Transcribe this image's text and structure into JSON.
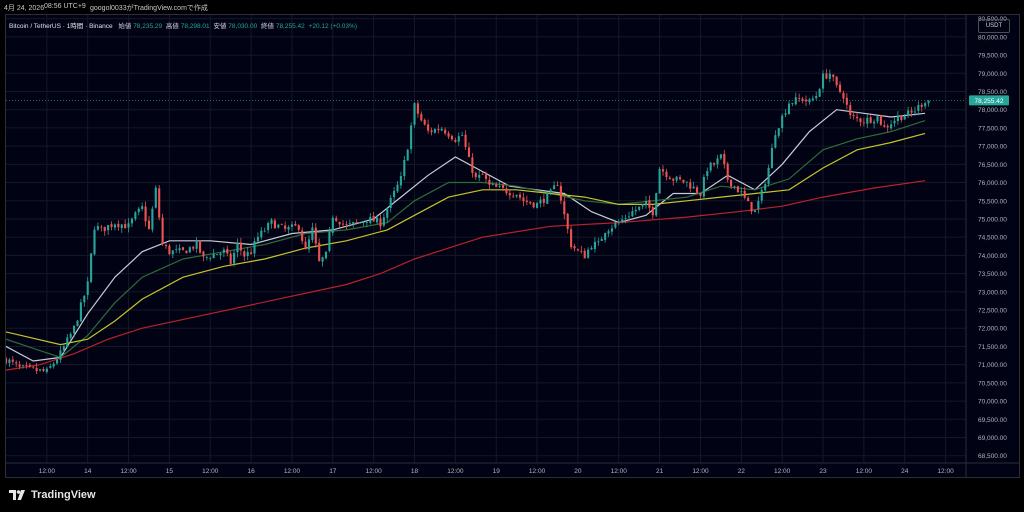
{
  "topbar": {
    "date": "4月 24, 2026",
    "time": "08:56 UTC+9",
    "created_by": "googol0033がTradingView.comで作成"
  },
  "legend": {
    "symbol": "Bitcoin / TetherUS · 1時間 · Binance",
    "open_label": "始値",
    "open": "78,235.29",
    "high_label": "高値",
    "high": "78,298.01",
    "low_label": "安値",
    "low": "78,030.00",
    "close_label": "終値",
    "close": "78,255.42",
    "change": "+20.12 (+0.03%)"
  },
  "currency_button": "USDT",
  "footer": {
    "brand": "TradingView"
  },
  "colors": {
    "background": "#010314",
    "grid": "#141827",
    "up": "#26a69a",
    "down": "#ef5350",
    "ma_short": "#c9cbd6",
    "ma_mid": "#2e6b3a",
    "ma_long": "#c7c42a",
    "ma_200": "#b8222a"
  },
  "chart_data": {
    "type": "candlestick",
    "instrument": "BTC/USDT",
    "interval": "1時間",
    "exchange": "Binance",
    "y_range": [
      68300,
      80600
    ],
    "y_ticks": [
      "68,500.00",
      "69,000.00",
      "69,500.00",
      "70,000.00",
      "70,500.00",
      "71,000.00",
      "71,500.00",
      "72,000.00",
      "72,500.00",
      "73,000.00",
      "73,500.00",
      "74,000.00",
      "74,500.00",
      "75,000.00",
      "75,500.00",
      "76,000.00",
      "76,500.00",
      "77,000.00",
      "77,500.00",
      "78,000.00",
      "78,500.00",
      "79,000.00",
      "79,500.00",
      "80,000.00",
      "80,500.00"
    ],
    "x_ticks": [
      {
        "label": "12:00",
        "hour": 12
      },
      {
        "label": "14",
        "hour": 24
      },
      {
        "label": "12:00",
        "hour": 36
      },
      {
        "label": "15",
        "hour": 48
      },
      {
        "label": "12:00",
        "hour": 60
      },
      {
        "label": "16",
        "hour": 72
      },
      {
        "label": "12:00",
        "hour": 84
      },
      {
        "label": "17",
        "hour": 96
      },
      {
        "label": "12:00",
        "hour": 108
      },
      {
        "label": "18",
        "hour": 120
      },
      {
        "label": "12:00",
        "hour": 132
      },
      {
        "label": "19",
        "hour": 144
      },
      {
        "label": "12:00",
        "hour": 156
      },
      {
        "label": "20",
        "hour": 168
      },
      {
        "label": "12:00",
        "hour": 180
      },
      {
        "label": "21",
        "hour": 192
      },
      {
        "label": "12:00",
        "hour": 204
      },
      {
        "label": "22",
        "hour": 216
      },
      {
        "label": "12:00",
        "hour": 228
      },
      {
        "label": "23",
        "hour": 240
      },
      {
        "label": "12:00",
        "hour": 252
      },
      {
        "label": "24",
        "hour": 264
      },
      {
        "label": "12:00",
        "hour": 276
      }
    ],
    "x_range_hours": [
      0,
      282
    ],
    "last_candle_hour": 271,
    "close_path": [
      [
        0,
        71150
      ],
      [
        4,
        70900
      ],
      [
        8,
        70850
      ],
      [
        12,
        70800
      ],
      [
        16,
        71300
      ],
      [
        20,
        72000
      ],
      [
        24,
        73200
      ],
      [
        26,
        74800
      ],
      [
        28,
        74700
      ],
      [
        32,
        74900
      ],
      [
        36,
        74800
      ],
      [
        38,
        75100
      ],
      [
        40,
        75300
      ],
      [
        42,
        74700
      ],
      [
        44,
        75800
      ],
      [
        46,
        74300
      ],
      [
        48,
        74100
      ],
      [
        52,
        74100
      ],
      [
        56,
        74300
      ],
      [
        58,
        73900
      ],
      [
        60,
        74000
      ],
      [
        64,
        74100
      ],
      [
        66,
        73800
      ],
      [
        68,
        74300
      ],
      [
        70,
        74000
      ],
      [
        72,
        74100
      ],
      [
        74,
        74500
      ],
      [
        78,
        74900
      ],
      [
        82,
        74700
      ],
      [
        86,
        74800
      ],
      [
        88,
        74100
      ],
      [
        90,
        74700
      ],
      [
        92,
        73800
      ],
      [
        94,
        74000
      ],
      [
        96,
        75100
      ],
      [
        100,
        74800
      ],
      [
        104,
        74900
      ],
      [
        106,
        75000
      ],
      [
        110,
        74900
      ],
      [
        112,
        75300
      ],
      [
        114,
        75700
      ],
      [
        116,
        76100
      ],
      [
        118,
        77000
      ],
      [
        120,
        78100
      ],
      [
        122,
        77700
      ],
      [
        124,
        77400
      ],
      [
        128,
        77500
      ],
      [
        132,
        77200
      ],
      [
        134,
        77300
      ],
      [
        136,
        76600
      ],
      [
        138,
        76100
      ],
      [
        140,
        76200
      ],
      [
        142,
        75900
      ],
      [
        146,
        75800
      ],
      [
        150,
        75700
      ],
      [
        152,
        75500
      ],
      [
        156,
        75400
      ],
      [
        160,
        75700
      ],
      [
        162,
        76000
      ],
      [
        164,
        75100
      ],
      [
        166,
        74300
      ],
      [
        168,
        74100
      ],
      [
        170,
        74000
      ],
      [
        172,
        74300
      ],
      [
        174,
        74300
      ],
      [
        176,
        74700
      ],
      [
        178,
        74800
      ],
      [
        180,
        74900
      ],
      [
        184,
        75200
      ],
      [
        186,
        75300
      ],
      [
        188,
        75400
      ],
      [
        190,
        75200
      ],
      [
        192,
        76400
      ],
      [
        196,
        76100
      ],
      [
        200,
        76000
      ],
      [
        204,
        75700
      ],
      [
        206,
        76400
      ],
      [
        208,
        76500
      ],
      [
        210,
        76700
      ],
      [
        212,
        76100
      ],
      [
        214,
        75900
      ],
      [
        216,
        75700
      ],
      [
        218,
        75400
      ],
      [
        220,
        75200
      ],
      [
        222,
        75700
      ],
      [
        224,
        76400
      ],
      [
        226,
        77400
      ],
      [
        228,
        77800
      ],
      [
        230,
        78200
      ],
      [
        234,
        78300
      ],
      [
        236,
        78200
      ],
      [
        238,
        78400
      ],
      [
        240,
        78900
      ],
      [
        242,
        79000
      ],
      [
        244,
        78600
      ],
      [
        246,
        78400
      ],
      [
        248,
        77800
      ],
      [
        252,
        77700
      ],
      [
        256,
        77800
      ],
      [
        258,
        77500
      ],
      [
        262,
        77800
      ],
      [
        266,
        77900
      ],
      [
        270,
        78255
      ]
    ],
    "moving_averages": [
      {
        "color": "#c9cbd6",
        "points": [
          [
            0,
            71500
          ],
          [
            8,
            71100
          ],
          [
            16,
            71200
          ],
          [
            24,
            72400
          ],
          [
            32,
            73400
          ],
          [
            40,
            74100
          ],
          [
            48,
            74400
          ],
          [
            60,
            74400
          ],
          [
            72,
            74300
          ],
          [
            84,
            74600
          ],
          [
            96,
            74700
          ],
          [
            108,
            75000
          ],
          [
            116,
            75600
          ],
          [
            124,
            76200
          ],
          [
            132,
            76700
          ],
          [
            140,
            76300
          ],
          [
            148,
            75900
          ],
          [
            156,
            75800
          ],
          [
            164,
            75700
          ],
          [
            172,
            75200
          ],
          [
            180,
            74900
          ],
          [
            188,
            75100
          ],
          [
            196,
            75700
          ],
          [
            204,
            75700
          ],
          [
            212,
            76200
          ],
          [
            220,
            75800
          ],
          [
            228,
            76500
          ],
          [
            236,
            77400
          ],
          [
            244,
            78000
          ],
          [
            252,
            77900
          ],
          [
            260,
            77800
          ],
          [
            270,
            77900
          ]
        ]
      },
      {
        "color": "#2e6b3a",
        "points": [
          [
            0,
            71700
          ],
          [
            16,
            71200
          ],
          [
            24,
            71800
          ],
          [
            32,
            72700
          ],
          [
            40,
            73400
          ],
          [
            52,
            73900
          ],
          [
            64,
            74100
          ],
          [
            76,
            74300
          ],
          [
            88,
            74600
          ],
          [
            100,
            74700
          ],
          [
            112,
            74900
          ],
          [
            120,
            75500
          ],
          [
            130,
            76000
          ],
          [
            140,
            76000
          ],
          [
            150,
            75900
          ],
          [
            160,
            75700
          ],
          [
            170,
            75500
          ],
          [
            180,
            75400
          ],
          [
            190,
            75500
          ],
          [
            200,
            75600
          ],
          [
            210,
            75900
          ],
          [
            220,
            75800
          ],
          [
            230,
            76100
          ],
          [
            240,
            76900
          ],
          [
            250,
            77200
          ],
          [
            260,
            77400
          ],
          [
            270,
            77700
          ]
        ]
      },
      {
        "color": "#c7c42a",
        "points": [
          [
            0,
            71900
          ],
          [
            16,
            71550
          ],
          [
            24,
            71700
          ],
          [
            32,
            72200
          ],
          [
            40,
            72800
          ],
          [
            52,
            73400
          ],
          [
            64,
            73700
          ],
          [
            76,
            73900
          ],
          [
            88,
            74200
          ],
          [
            100,
            74400
          ],
          [
            112,
            74700
          ],
          [
            120,
            75100
          ],
          [
            130,
            75600
          ],
          [
            140,
            75800
          ],
          [
            150,
            75800
          ],
          [
            160,
            75700
          ],
          [
            170,
            75600
          ],
          [
            180,
            75400
          ],
          [
            190,
            75400
          ],
          [
            200,
            75500
          ],
          [
            210,
            75600
          ],
          [
            220,
            75700
          ],
          [
            230,
            75800
          ],
          [
            240,
            76400
          ],
          [
            250,
            76900
          ],
          [
            260,
            77100
          ],
          [
            270,
            77350
          ]
        ]
      },
      {
        "color": "#b8222a",
        "points": [
          [
            0,
            70850
          ],
          [
            10,
            71000
          ],
          [
            20,
            71300
          ],
          [
            30,
            71700
          ],
          [
            40,
            72000
          ],
          [
            60,
            72400
          ],
          [
            80,
            72800
          ],
          [
            100,
            73200
          ],
          [
            110,
            73500
          ],
          [
            120,
            73900
          ],
          [
            130,
            74200
          ],
          [
            140,
            74500
          ],
          [
            160,
            74800
          ],
          [
            180,
            74900
          ],
          [
            200,
            75050
          ],
          [
            215,
            75200
          ],
          [
            228,
            75350
          ],
          [
            240,
            75600
          ],
          [
            255,
            75850
          ],
          [
            270,
            76050
          ]
        ]
      }
    ]
  }
}
